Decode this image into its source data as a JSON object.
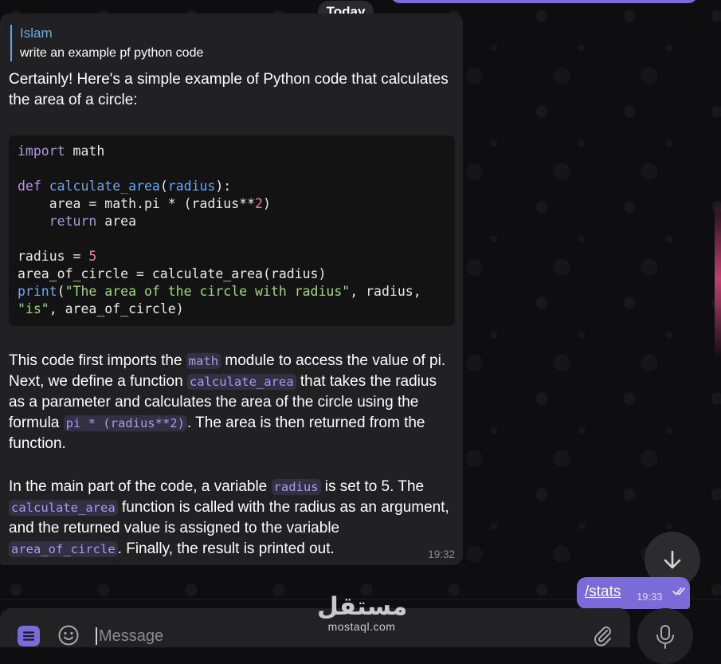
{
  "date_separator": "Today",
  "message": {
    "reply": {
      "name": "Islam",
      "text": "write an example pf python code"
    },
    "intro": "Certainly! Here's a simple example of Python code that calculates the area of a circle:",
    "code": {
      "import_kw": "import",
      "import_mod": " math",
      "def_kw": "def",
      "fn_name": "calculate_area",
      "param_open": "(",
      "param": "radius",
      "param_close": "):",
      "area_line": "    area = math.pi * (radius**",
      "area_num": "2",
      "area_close": ")",
      "return_indent": "    ",
      "return_kw": "return",
      "return_val": " area",
      "radius_assign": "radius = ",
      "radius_num": "5",
      "area_of_circle_line": "area_of_circle = calculate_area(radius)",
      "print_fn": "print",
      "print_paren": "(",
      "print_str": "\"The area of the circle with radius\"",
      "print_rest": ", radius,",
      "print_str2": "\"is\"",
      "print_end": ", area_of_circle)"
    },
    "para1": {
      "a": "This code first imports the ",
      "code1": "math",
      "b": " module to access the value of pi. Next, we define a function ",
      "code2": "calculate_area",
      "c": " that takes the radius as a parameter and calculates the area of the circle using the formula ",
      "code3": "pi * (radius**2)",
      "d": ". The area is then returned from the function."
    },
    "para2": {
      "a": "In the main part of the code, a variable ",
      "code1": "radius",
      "b": " is set to 5. The ",
      "code2": "calculate_area",
      "c": " function is called with the radius as an argument, and the returned value is assigned to the variable ",
      "code3": "area_of_circle",
      "d": ". Finally, the result is printed out."
    },
    "time": "19:32"
  },
  "sent_message": {
    "text": "/stats",
    "time": "19:33"
  },
  "composer": {
    "placeholder": "Message"
  },
  "watermark": {
    "arabic": "مستقل",
    "latin": "mostaql.com"
  },
  "icons": {
    "menu": "menu-icon",
    "emoji": "emoji-icon",
    "attach": "paperclip-icon",
    "mic": "microphone-icon",
    "scroll_down": "arrow-down-icon",
    "read": "double-check-icon"
  },
  "colors": {
    "accent": "#7a6bd8",
    "bubble": "#212123",
    "reply_name": "#62aee8",
    "code_bg": "#131314",
    "keyword": "#b594e8",
    "function": "#6aa8f2",
    "number": "#f08287",
    "string": "#9ed97a"
  }
}
